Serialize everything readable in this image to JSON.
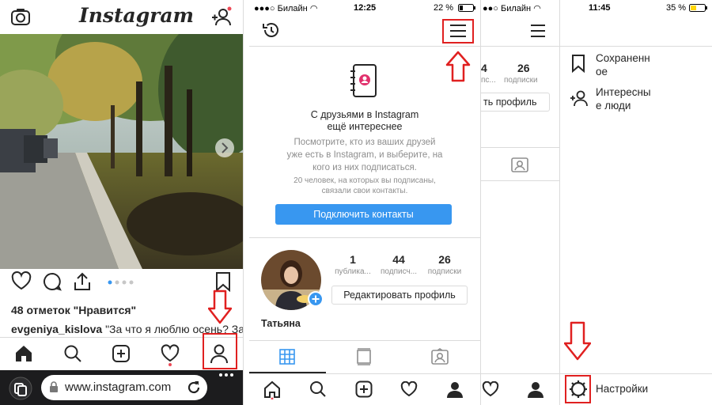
{
  "panel1": {
    "logo": "Instagram",
    "likes": "48 отметок \"Нравится\"",
    "caption_user": "evgeniya_kislova",
    "caption_text": " \"За что я люблю осень? За",
    "browser_url": "www.instagram.com"
  },
  "panel2": {
    "status": {
      "carrier": "Билайн",
      "time": "12:25",
      "battery": "22 %"
    },
    "promo_title": "С друзьями в Instagram\nещё интереснее",
    "promo_text": "Посмотрите, кто из ваших друзей\nуже есть в Instagram, и выберите, на\nкого из них подписаться.",
    "promo_small": "20 человек, на которых вы подписаны,\nсвязали свои контакты.",
    "connect_button": "Подключить контакты",
    "stats": [
      {
        "value": "1",
        "label": "публика..."
      },
      {
        "value": "44",
        "label": "подписч..."
      },
      {
        "value": "26",
        "label": "подписки"
      }
    ],
    "edit_profile": "Редактировать профиль",
    "name": "Татьяна"
  },
  "panel3": {
    "status": {
      "carrier": "Билайн"
    },
    "stat_value": "26",
    "stat_left": "4",
    "label_left": "пс...",
    "label_right": "подписки",
    "edit_partial": "ть профиль"
  },
  "panel4": {
    "status": {
      "time": "11:45",
      "battery": "35 %"
    },
    "menu": [
      {
        "label": "Сохраненн\nое",
        "icon": "bookmark-icon"
      },
      {
        "label": "Интересны\nе люди",
        "icon": "add-person-icon"
      }
    ],
    "settings": "Настройки"
  },
  "colors": {
    "accent": "#3897f0",
    "highlight": "#e02020",
    "battery": "#ffd60a"
  }
}
